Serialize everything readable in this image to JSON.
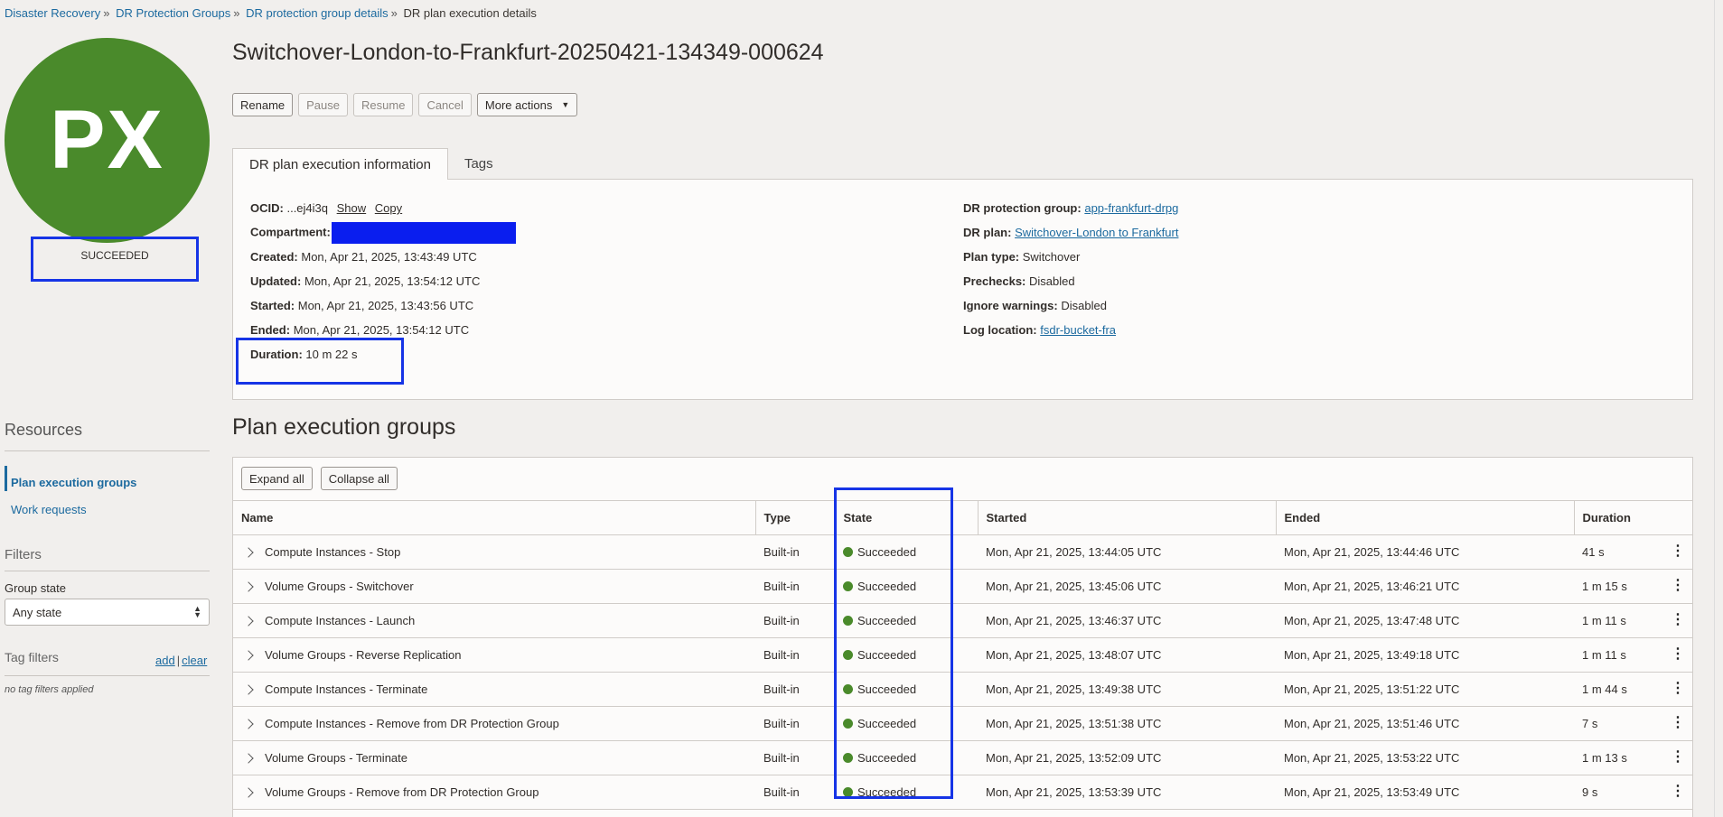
{
  "breadcrumb": [
    {
      "label": "Disaster Recovery"
    },
    {
      "label": "DR Protection Groups"
    },
    {
      "label": "DR protection group details"
    },
    {
      "label": "DR plan execution details"
    }
  ],
  "avatar": {
    "initials": "PX",
    "color": "#4a8a2b"
  },
  "status": "SUCCEEDED",
  "title": "Switchover-London-to-Frankfurt-20250421-134349-000624",
  "toolbar": {
    "rename": "Rename",
    "pause": "Pause",
    "resume": "Resume",
    "cancel": "Cancel",
    "more_actions": "More actions"
  },
  "tabs": {
    "info": "DR plan execution information",
    "tags": "Tags"
  },
  "info": {
    "ocid_label": "OCID:",
    "ocid_value": "...ej4i3q",
    "show": "Show",
    "copy": "Copy",
    "compartment_label": "Compartment:",
    "created_label": "Created:",
    "created_value": "Mon, Apr 21, 2025, 13:43:49 UTC",
    "updated_label": "Updated:",
    "updated_value": "Mon, Apr 21, 2025, 13:54:12 UTC",
    "started_label": "Started:",
    "started_value": "Mon, Apr 21, 2025, 13:43:56 UTC",
    "ended_label": "Ended:",
    "ended_value": "Mon, Apr 21, 2025, 13:54:12 UTC",
    "duration_label": "Duration:",
    "duration_value": "10 m 22 s",
    "drpg_label": "DR protection group:",
    "drpg_value": "app-frankfurt-drpg",
    "plan_label": "DR plan:",
    "plan_value": "Switchover-London to Frankfurt",
    "plan_type_label": "Plan type:",
    "plan_type_value": "Switchover",
    "prechecks_label": "Prechecks:",
    "prechecks_value": "Disabled",
    "ignore_label": "Ignore warnings:",
    "ignore_value": "Disabled",
    "log_label": "Log location:",
    "log_value": "fsdr-bucket-fra"
  },
  "resources": {
    "title": "Resources",
    "items": [
      {
        "label": "Plan execution groups"
      },
      {
        "label": "Work requests"
      }
    ]
  },
  "filters": {
    "title": "Filters",
    "group_state_label": "Group state",
    "group_state_value": "Any state",
    "tag_filters_title": "Tag filters",
    "add": "add",
    "clear": "clear",
    "no_tags": "no tag filters applied"
  },
  "groups": {
    "title": "Plan execution groups",
    "expand_all": "Expand all",
    "collapse_all": "Collapse all",
    "columns": {
      "name": "Name",
      "type": "Type",
      "state": "State",
      "started": "Started",
      "ended": "Ended",
      "duration": "Duration"
    },
    "rows": [
      {
        "name": "Compute Instances - Stop",
        "type": "Built-in",
        "state": "Succeeded",
        "started": "Mon, Apr 21, 2025, 13:44:05 UTC",
        "ended": "Mon, Apr 21, 2025, 13:44:46 UTC",
        "duration": "41 s"
      },
      {
        "name": "Volume Groups - Switchover",
        "type": "Built-in",
        "state": "Succeeded",
        "started": "Mon, Apr 21, 2025, 13:45:06 UTC",
        "ended": "Mon, Apr 21, 2025, 13:46:21 UTC",
        "duration": "1 m 15 s"
      },
      {
        "name": "Compute Instances - Launch",
        "type": "Built-in",
        "state": "Succeeded",
        "started": "Mon, Apr 21, 2025, 13:46:37 UTC",
        "ended": "Mon, Apr 21, 2025, 13:47:48 UTC",
        "duration": "1 m 11 s"
      },
      {
        "name": "Volume Groups - Reverse Replication",
        "type": "Built-in",
        "state": "Succeeded",
        "started": "Mon, Apr 21, 2025, 13:48:07 UTC",
        "ended": "Mon, Apr 21, 2025, 13:49:18 UTC",
        "duration": "1 m 11 s"
      },
      {
        "name": "Compute Instances - Terminate",
        "type": "Built-in",
        "state": "Succeeded",
        "started": "Mon, Apr 21, 2025, 13:49:38 UTC",
        "ended": "Mon, Apr 21, 2025, 13:51:22 UTC",
        "duration": "1 m 44 s"
      },
      {
        "name": "Compute Instances - Remove from DR Protection Group",
        "type": "Built-in",
        "state": "Succeeded",
        "started": "Mon, Apr 21, 2025, 13:51:38 UTC",
        "ended": "Mon, Apr 21, 2025, 13:51:46 UTC",
        "duration": "7 s"
      },
      {
        "name": "Volume Groups - Terminate",
        "type": "Built-in",
        "state": "Succeeded",
        "started": "Mon, Apr 21, 2025, 13:52:09 UTC",
        "ended": "Mon, Apr 21, 2025, 13:53:22 UTC",
        "duration": "1 m 13 s"
      },
      {
        "name": "Volume Groups - Remove from DR Protection Group",
        "type": "Built-in",
        "state": "Succeeded",
        "started": "Mon, Apr 21, 2025, 13:53:39 UTC",
        "ended": "Mon, Apr 21, 2025, 13:53:49 UTC",
        "duration": "9 s"
      }
    ]
  },
  "colors": {
    "link": "#1c6a9f",
    "success": "#4a8a2b",
    "highlight": "#1634e6",
    "redaction": "#0a1eef"
  },
  "icons": {
    "expand": "chevron-right-icon",
    "row_actions": "kebab-menu-icon",
    "dropdown": "caret-down-icon",
    "select": "select-arrows-icon",
    "state": "status-dot-icon"
  }
}
